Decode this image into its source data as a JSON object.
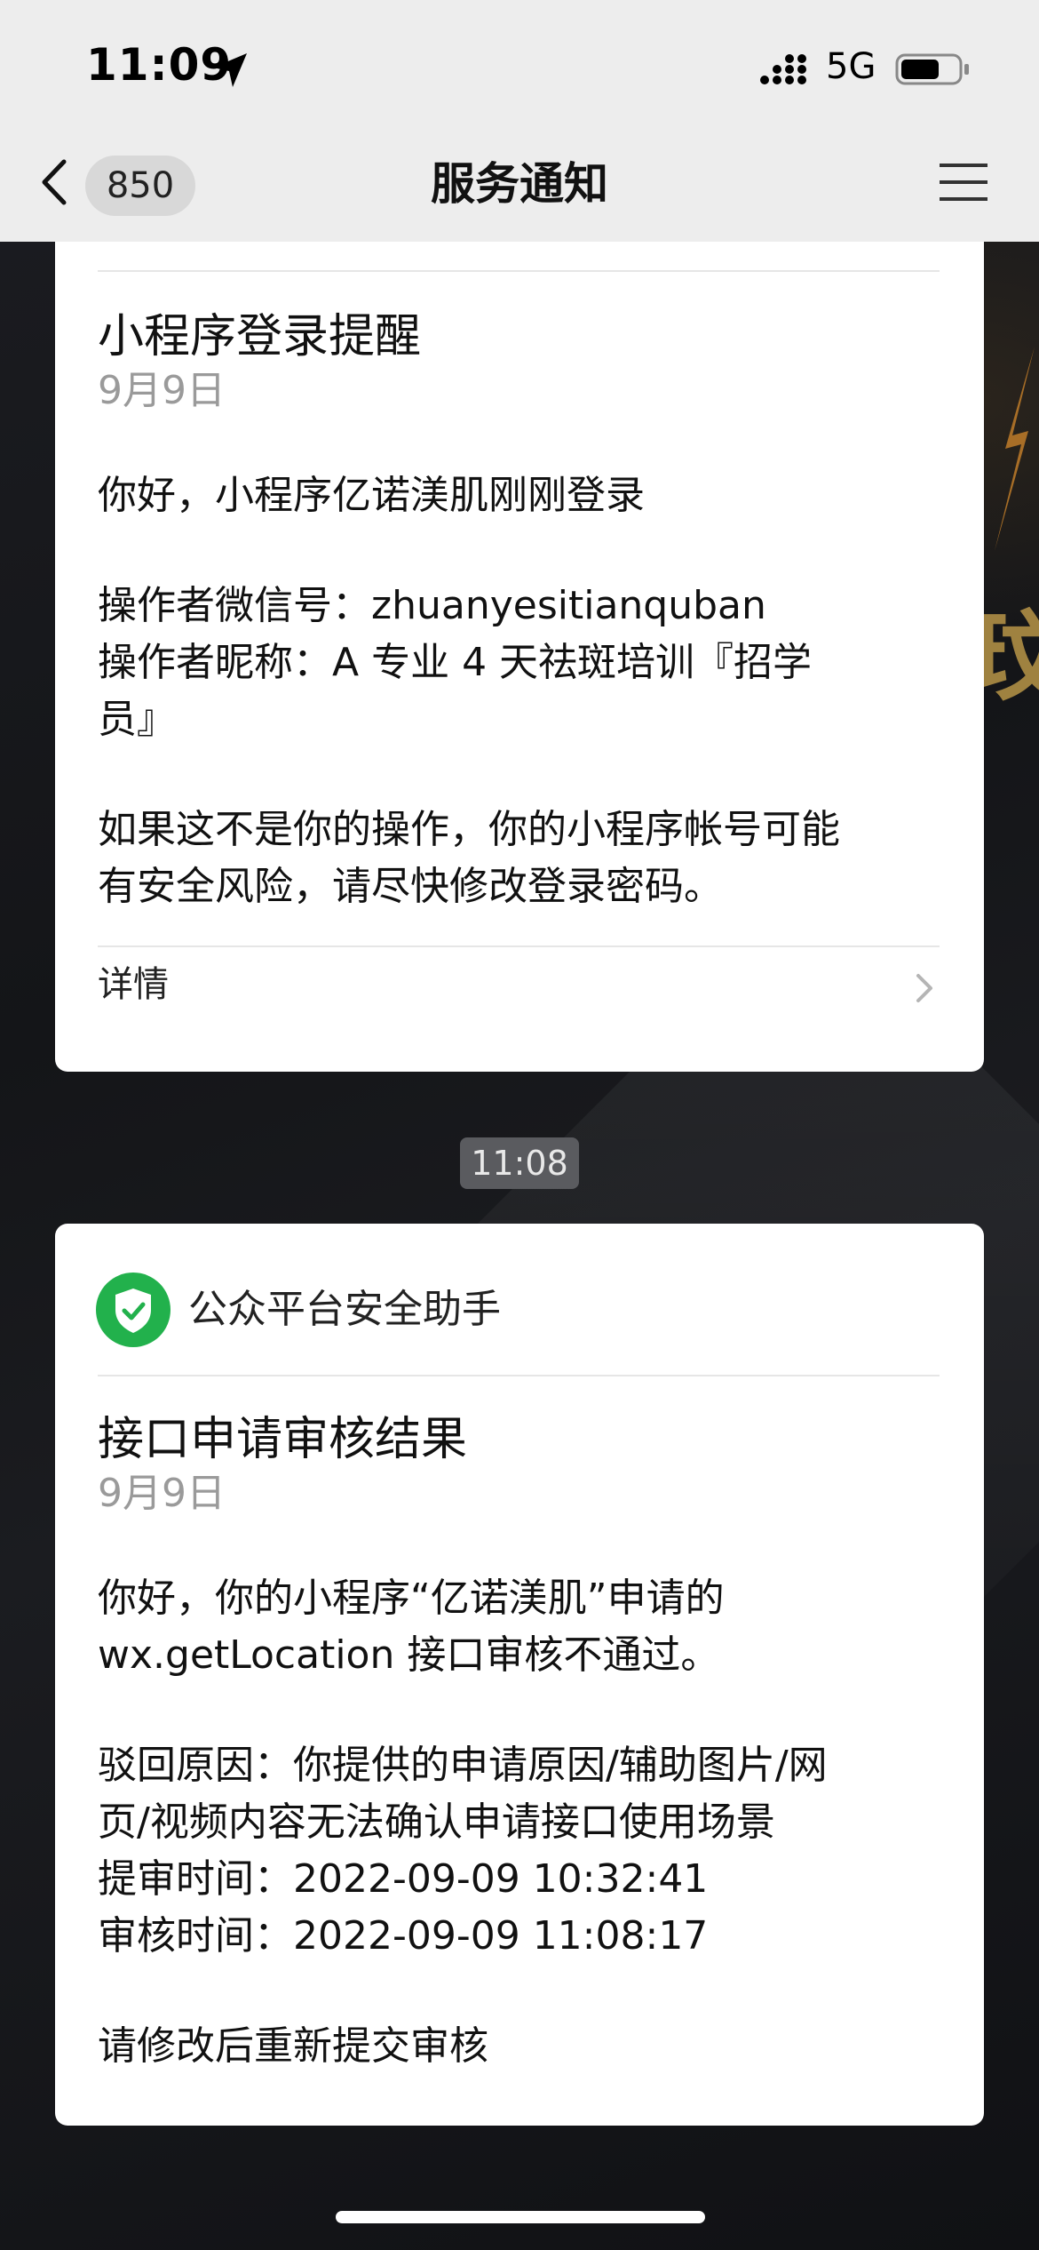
{
  "status_bar": {
    "time": "11:09",
    "network": "5G"
  },
  "nav": {
    "back_badge": "850",
    "title": "服务通知"
  },
  "background": {
    "glyph": "玟"
  },
  "messages": [
    {
      "title": "小程序登录提醒",
      "date": "9月9日",
      "lines": [
        "你好，小程序亿诺渼肌刚刚登录",
        "操作者微信号：zhuanyesitianquban",
        "操作者昵称：A 专业 4 天祛斑培训『招学",
        "员』",
        "如果这不是你的操作，你的小程序帐号可能",
        "有安全风险，请尽快修改登录密码。"
      ],
      "details_label": "详情"
    },
    {
      "sender": "公众平台安全助手",
      "sender_icon": "shield-check-icon",
      "title": "接口申请审核结果",
      "date": "9月9日",
      "lines": [
        "你好，你的小程序“亿诺渼肌”申请的",
        "wx.getLocation 接口审核不通过。",
        "驳回原因：你提供的申请原因/辅助图片/网",
        "页/视频内容无法确认申请接口使用场景",
        "提审时间：2022-09-09 10:32:41",
        "审核时间：2022-09-09 11:08:17",
        "请修改后重新提交审核"
      ]
    }
  ],
  "time_divider": "11:08",
  "colors": {
    "header_bg": "#ededed",
    "card_bg": "#ffffff",
    "secondary_text": "#9a9a9a",
    "shield_green": "#22b14c",
    "time_pill_bg": "#5a5b5f",
    "bg_dark": "#17181c"
  }
}
